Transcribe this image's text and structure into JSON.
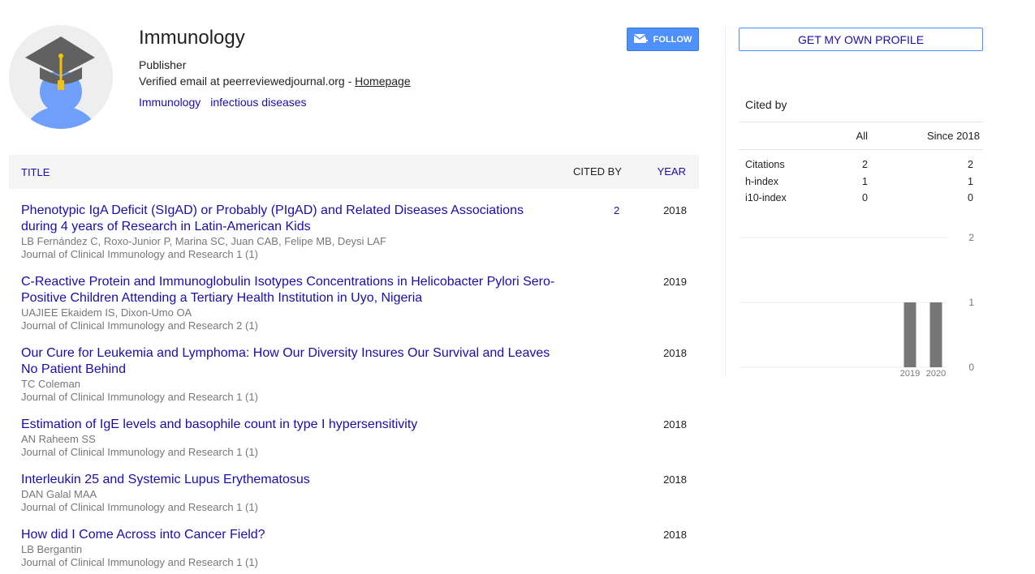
{
  "profile": {
    "name": "Immunology",
    "affiliation": "Publisher",
    "email_text": "Verified email at peerreviewedjournal.org - ",
    "homepage_label": "Homepage",
    "interests": [
      "Immunology",
      "infectious diseases"
    ],
    "follow_label": "FOLLOW",
    "avatar_icon": "graduate-cap-avatar-icon",
    "follow_icon": "mail-plus-icon"
  },
  "table": {
    "title_header": "TITLE",
    "cited_header": "CITED BY",
    "year_header": "YEAR",
    "articles": [
      {
        "title": "Phenotypic IgA Deficit (SIgAD) or Probably (PIgAD) and Related Diseases Associations during 4 years of Research in Latin-American Kids",
        "authors": "LB Fernández C, Roxo-Junior P, Marina SC, Juan CAB, Felipe MB, Deysi LAF",
        "venue": "Journal of Clinical Immunology and Research 1 (1)",
        "cited_by": "2",
        "year": "2018"
      },
      {
        "title": "C-Reactive Protein and Immunoglobulin Isotypes Concentrations in Helicobacter Pylori Sero-Positive Children Attending a Tertiary Health Institution in Uyo, Nigeria",
        "authors": "UAJIEE Ekaidem IS, Dixon-Umo OA",
        "venue": "Journal of Clinical Immunology and Research 2 (1)",
        "cited_by": "",
        "year": "2019"
      },
      {
        "title": "Our Cure for Leukemia and Lymphoma: How Our Diversity Insures Our Survival and Leaves No Patient Behind",
        "authors": "TC Coleman",
        "venue": "Journal of Clinical Immunology and Research 1 (1)",
        "cited_by": "",
        "year": "2018"
      },
      {
        "title": "Estimation of IgE levels and basophile count in type I hypersensitivity",
        "authors": "AN Raheem SS",
        "venue": "Journal of Clinical Immunology and Research 1 (1)",
        "cited_by": "",
        "year": "2018"
      },
      {
        "title": "Interleukin 25 and Systemic Lupus Erythematosus",
        "authors": "DAN Galal MAA",
        "venue": "Journal of Clinical Immunology and Research 1 (1)",
        "cited_by": "",
        "year": "2018"
      },
      {
        "title": "How did I Come Across into Cancer Field?",
        "authors": "LB Bergantin",
        "venue": "Journal of Clinical Immunology and Research 1 (1)",
        "cited_by": "",
        "year": "2018"
      }
    ]
  },
  "sidebar": {
    "profile_button": "GET MY OWN PROFILE",
    "cited_by_title": "Cited by",
    "col_all": "All",
    "col_since": "Since 2018",
    "metrics": [
      {
        "label": "Citations",
        "all": "2",
        "since": "2"
      },
      {
        "label": "h-index",
        "all": "1",
        "since": "1"
      },
      {
        "label": "i10-index",
        "all": "0",
        "since": "0"
      }
    ]
  },
  "chart_data": {
    "type": "bar",
    "categories": [
      "2019",
      "2020"
    ],
    "values": [
      1,
      1
    ],
    "ylim": [
      0,
      2
    ],
    "yticks": [
      "0",
      "1",
      "2"
    ],
    "grid": true,
    "bar_color": "#777777",
    "grid_color": "#eeeeee"
  },
  "colors": {
    "link": "#1a0dab",
    "accent": "#4d90fe",
    "muted": "#777777"
  }
}
